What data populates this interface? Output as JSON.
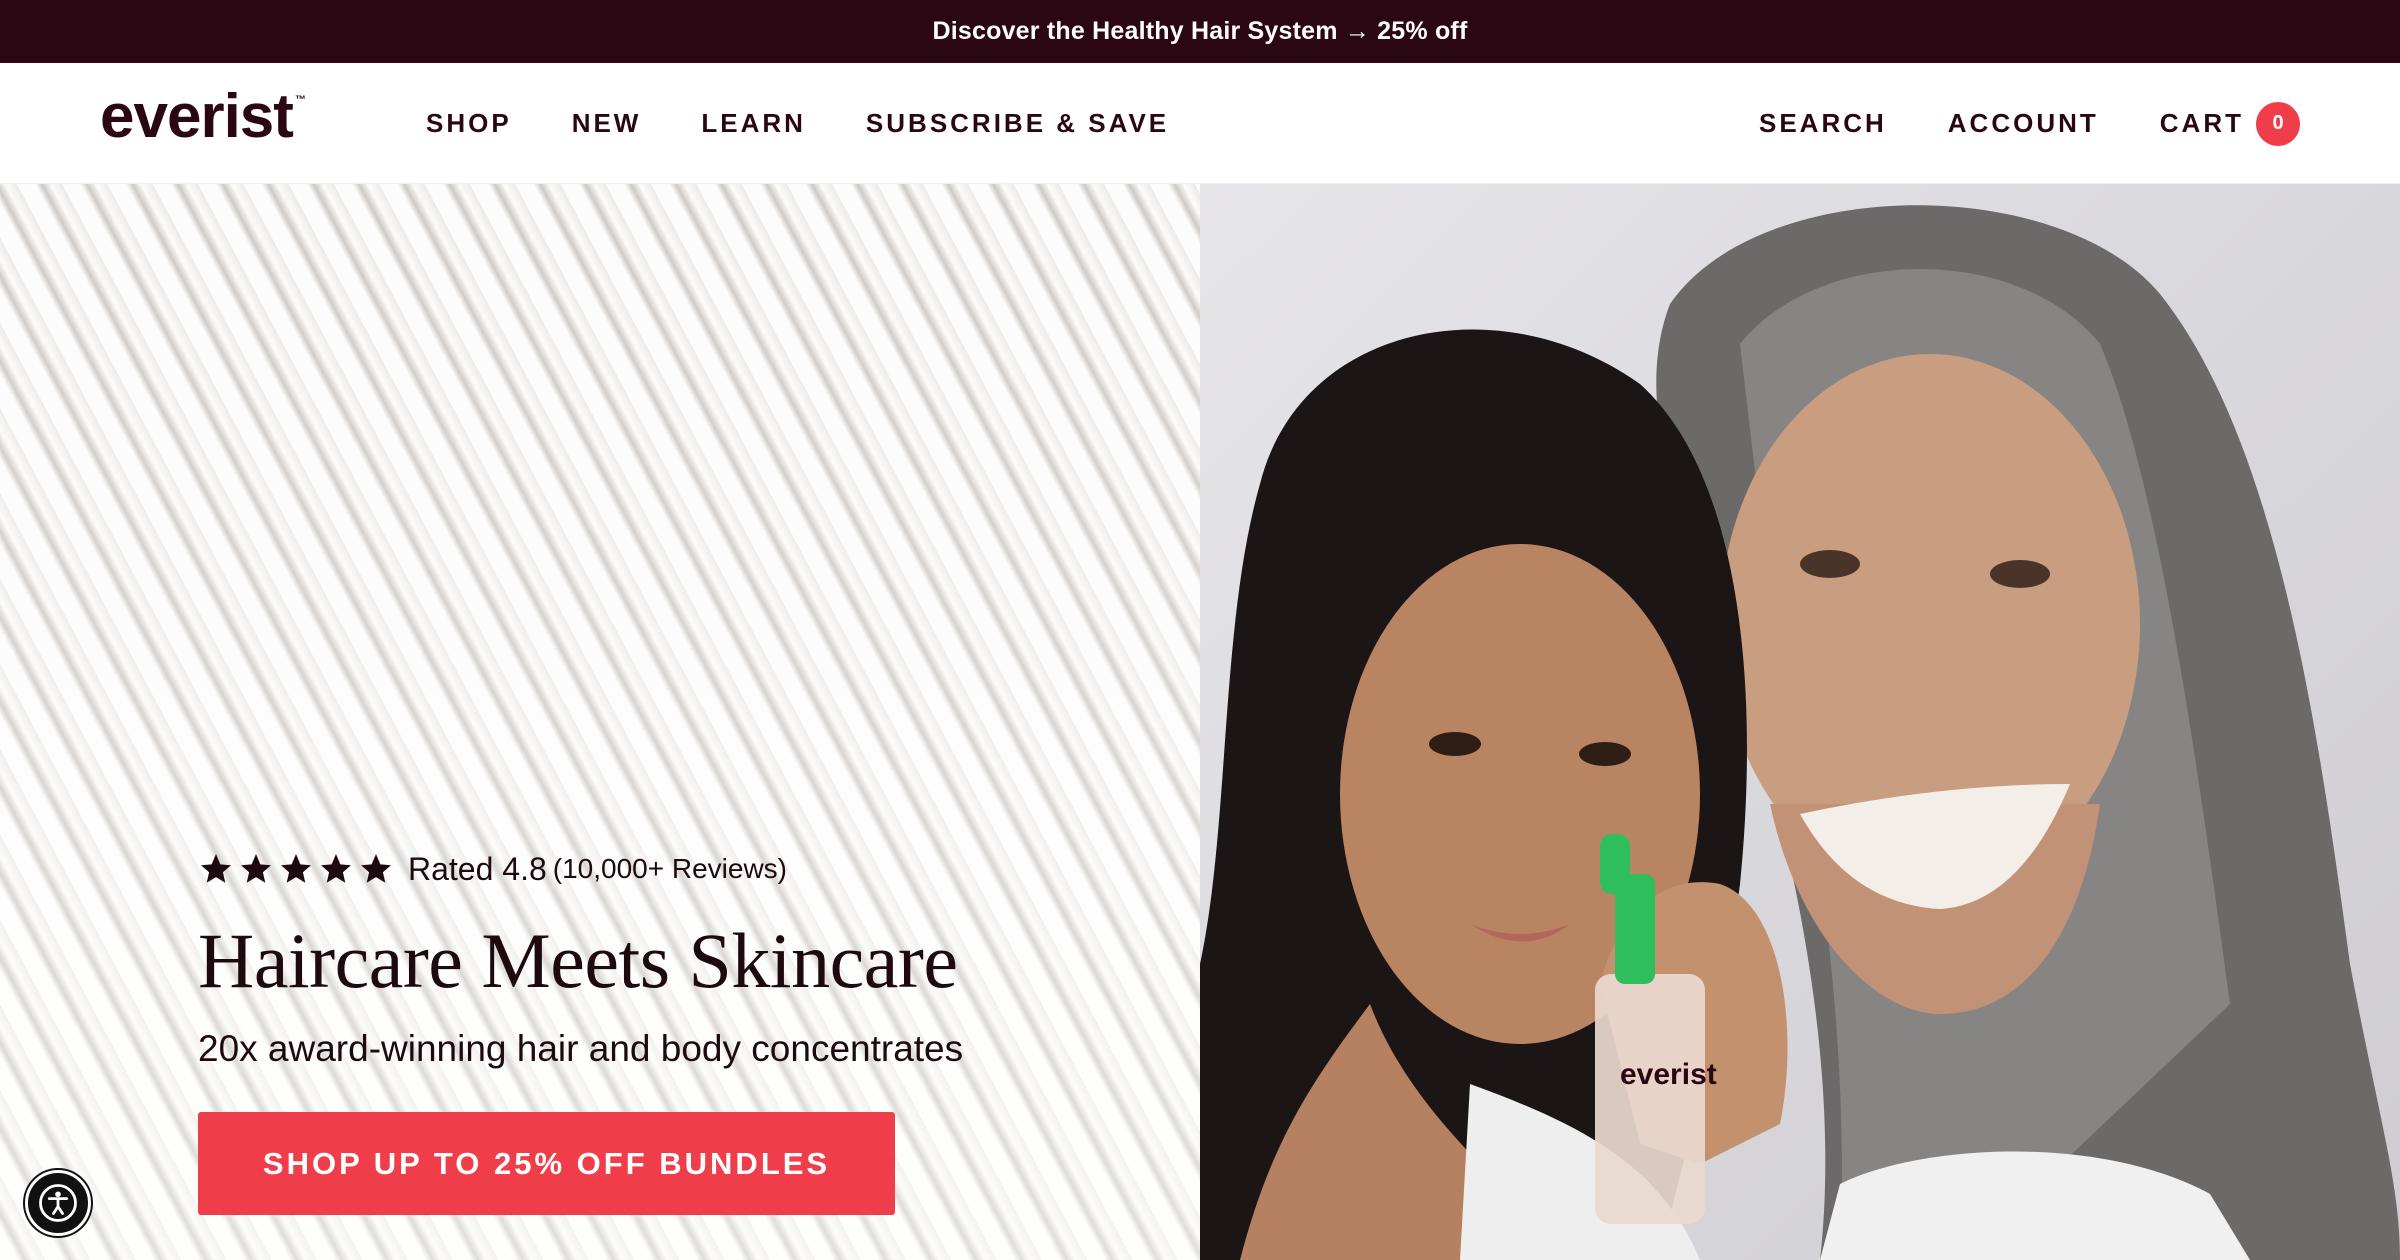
{
  "announcement": {
    "text": "Discover the Healthy Hair System → 25% off"
  },
  "header": {
    "logo": "everist",
    "logo_mark": "™",
    "nav_left": [
      "SHOP",
      "NEW",
      "LEARN",
      "SUBSCRIBE & SAVE"
    ],
    "search_label": "SEARCH",
    "account_label": "ACCOUNT",
    "cart_label": "CART",
    "cart_count": "0"
  },
  "hero": {
    "rating_value": "Rated 4.8",
    "rating_count": "(10,000+ Reviews)",
    "stars": 5,
    "headline": "Haircare Meets Skincare",
    "subhead": "20x award-winning hair and body concentrates",
    "cta_label": "SHOP UP TO 25% OFF BUNDLES",
    "bottle_label": "everist"
  },
  "colors": {
    "announcement_bg": "#2b0713",
    "brand_dark": "#2b0713",
    "cta_red": "#ef3e4a",
    "bottle_green": "#2fbe5c"
  },
  "icons": {
    "star": "star-icon",
    "accessibility": "accessibility-icon"
  }
}
